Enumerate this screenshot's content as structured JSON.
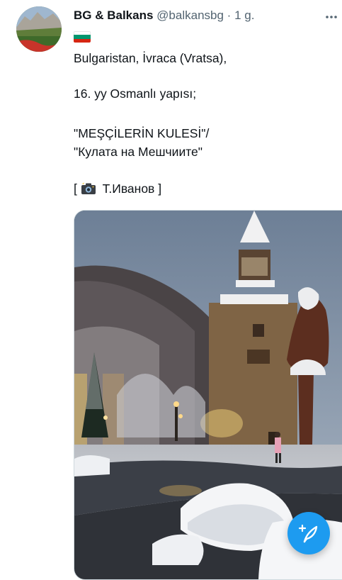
{
  "tweet": {
    "display_name": "BG & Balkans",
    "handle": "@balkansbg",
    "separator": "·",
    "time": "1 g.",
    "flag_icon": "bulgaria-flag-icon",
    "lines": [
      "Bulgaristan, İvraca (Vratsa),",
      "16. yy Osmanlı yapısı;",
      "\"MEŞÇİLERİN KULESİ\"/",
      "\"Кулата на Мешчиите\"",
      "[",
      "Т.Иванов ]"
    ],
    "camera_icon": "camera-icon",
    "more_icon": "more-icon"
  },
  "colors": {
    "accent": "#1d9bf0",
    "text": "#0f1419",
    "secondary": "#536471",
    "flag": [
      "#ffffff",
      "#00966e",
      "#d62612"
    ]
  },
  "compose": {
    "icon": "compose-tweet-icon"
  }
}
